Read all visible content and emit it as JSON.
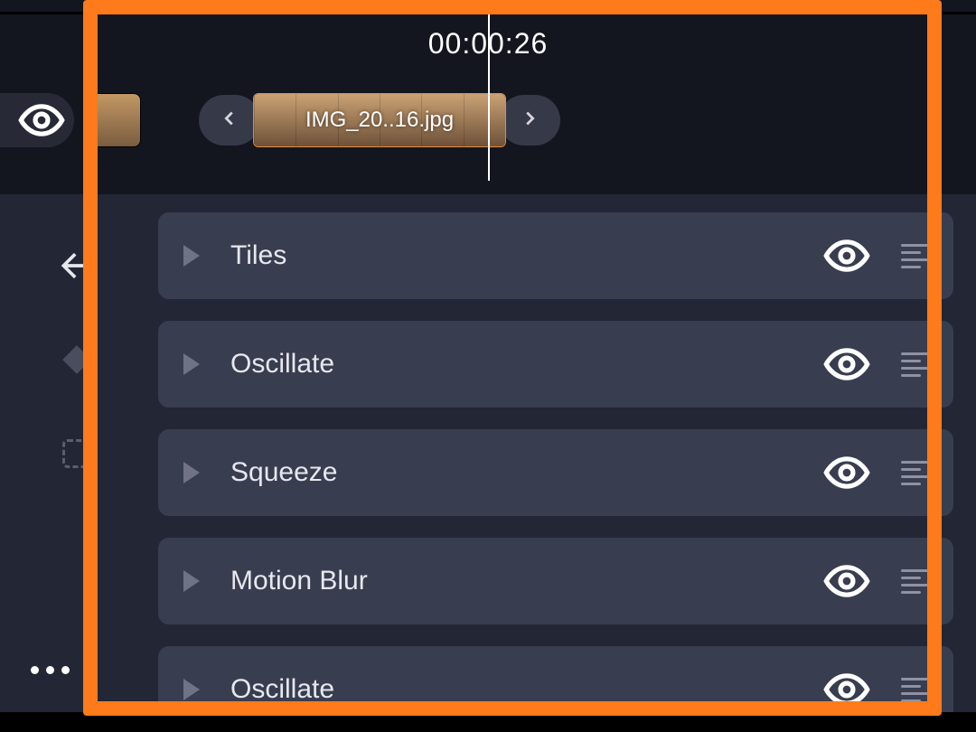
{
  "timeline": {
    "timecode": "00:00:26",
    "clip_label": "IMG_20..16.jpg"
  },
  "effects": {
    "items": [
      {
        "name": "Tiles"
      },
      {
        "name": "Oscillate"
      },
      {
        "name": "Squeeze"
      },
      {
        "name": "Motion Blur"
      },
      {
        "name": "Oscillate"
      }
    ]
  }
}
